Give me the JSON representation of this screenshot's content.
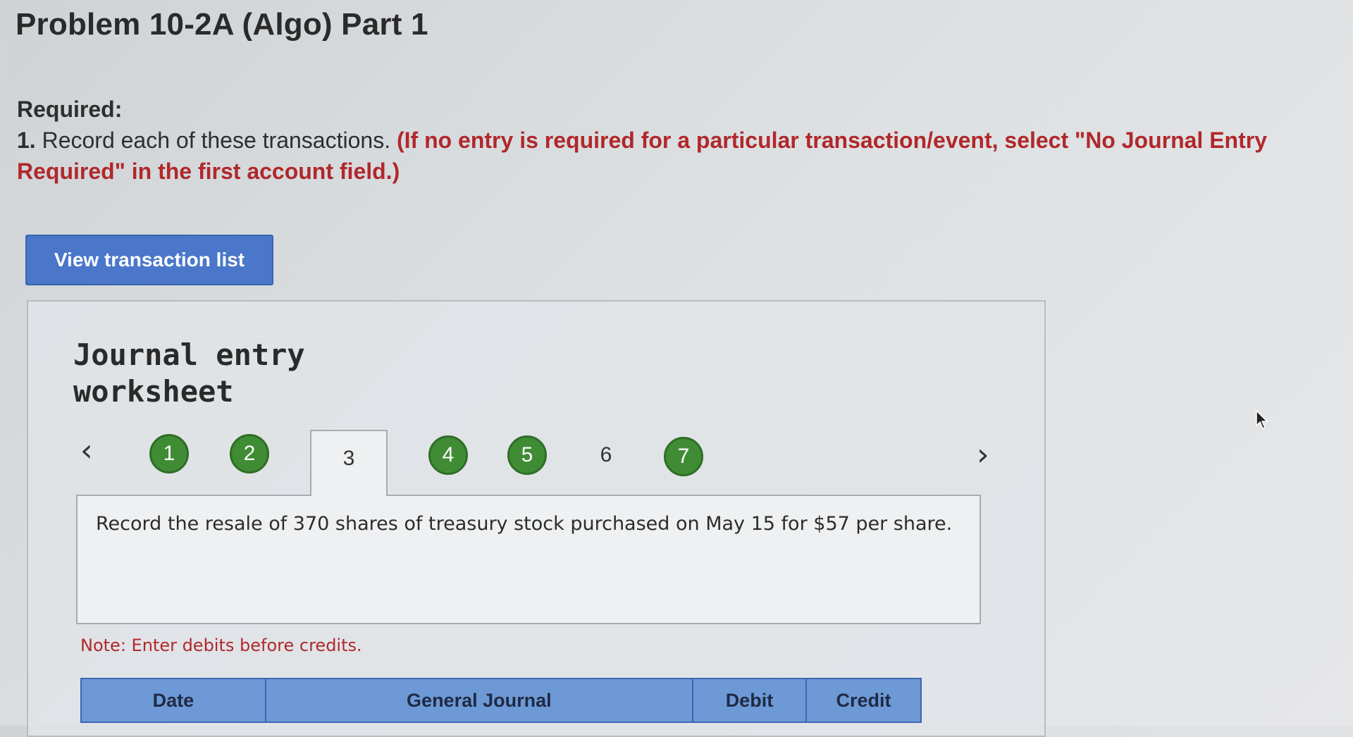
{
  "page": {
    "title": "Problem 10-2A (Algo) Part 1"
  },
  "required": {
    "heading": "Required:",
    "item_number": "1.",
    "item_text": "Record each of these transactions.",
    "instruction": "(If no entry is required for a particular transaction/event, select \"No Journal Entry Required\" in the first account field.)"
  },
  "buttons": {
    "view_transaction_list": "View transaction list"
  },
  "worksheet": {
    "title": "Journal entry worksheet",
    "nav_prev_icon": "chevron-left-icon",
    "nav_next_icon": "chevron-right-icon",
    "steps": [
      {
        "label": "1",
        "state": "completed"
      },
      {
        "label": "2",
        "state": "completed"
      },
      {
        "label": "3",
        "state": "active"
      },
      {
        "label": "4",
        "state": "completed"
      },
      {
        "label": "5",
        "state": "completed"
      },
      {
        "label": "6",
        "state": "incomplete"
      },
      {
        "label": "7",
        "state": "completed"
      }
    ],
    "description": "Record the resale of 370 shares of treasury stock purchased on May 15 for $57 per share.",
    "note": "Note: Enter debits before credits.",
    "table": {
      "headers": [
        "Date",
        "General Journal",
        "Debit",
        "Credit"
      ]
    }
  },
  "colors": {
    "accent_blue": "#4a77c9",
    "header_blue": "#6d9ad6",
    "completed_green": "#3f8c34",
    "instruction_red": "#b0282b"
  }
}
